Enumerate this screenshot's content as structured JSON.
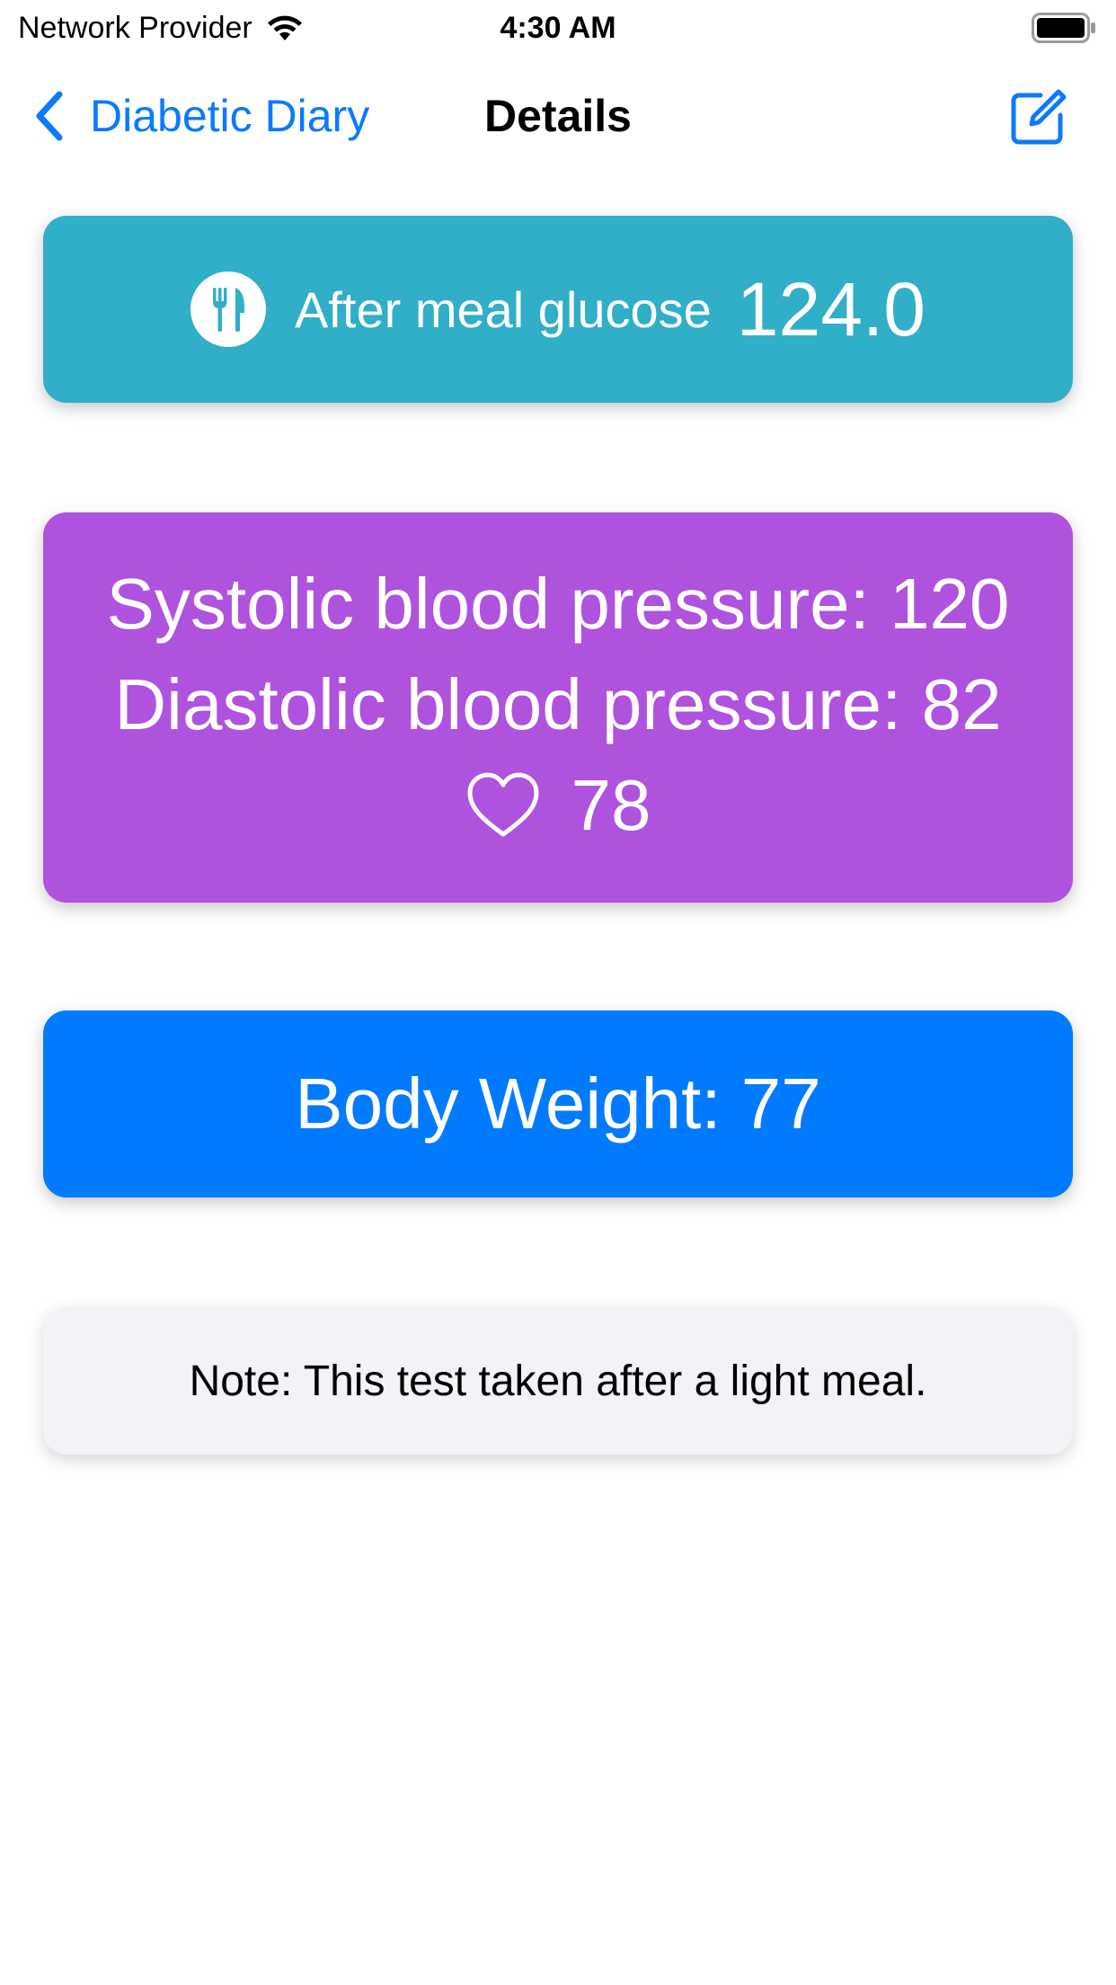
{
  "status_bar": {
    "carrier": "Network Provider",
    "time": "4:30 AM",
    "icons": [
      "wifi-icon",
      "battery-icon"
    ]
  },
  "nav": {
    "back_label": "Diabetic Diary",
    "title": "Details",
    "right_icon": "compose-icon",
    "accent_color": "#0a7aff"
  },
  "glucose": {
    "icon": "fork-knife-icon",
    "label": "After meal glucose",
    "value": "124.0",
    "color": "#31aec8"
  },
  "blood_pressure": {
    "systolic": "Systolic blood pressure: 120",
    "diastolic": "Diastolic blood pressure: 82",
    "heart_icon": "heart-icon",
    "heart_rate": "78",
    "color": "#af52de"
  },
  "weight": {
    "text": "Body Weight: 77",
    "color": "#007aff"
  },
  "note": {
    "text": "Note: This test taken after a light meal.",
    "color": "#f2f2f7"
  }
}
